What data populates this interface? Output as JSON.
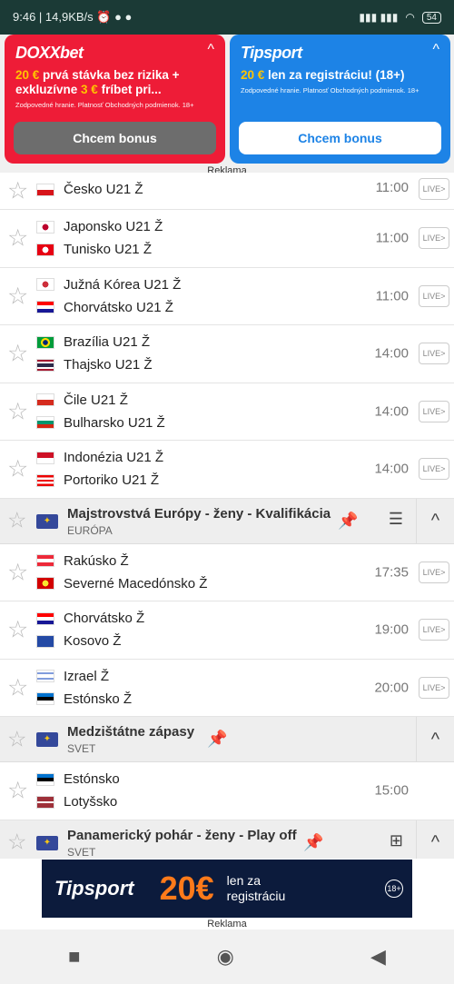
{
  "status": {
    "left": "9:46 | 14,9KB/s ⏰ ● ●",
    "right_signal": "▮▮▮ ▮▮▮",
    "wifi": "◠",
    "battery": "54"
  },
  "ads": {
    "doxx": {
      "logo": "DOXXbet",
      "chevron": "^",
      "text_a": "20 €",
      "text_b": " prvá stávka bez rizika + exkluzívne ",
      "text_c": "3 €",
      "text_d": " fríbet pri...",
      "small": "Zodpovedné hranie. Platnosť Obchodných podmienok. 18+",
      "button": "Chcem bonus"
    },
    "tip": {
      "logo": "Tipsport",
      "chevron": "^",
      "text_a": "20 €",
      "text_b": " len za registráciu! (18+)",
      "small": "Zodpovedné hranie. Platnosť Obchodných podmienok. 18+",
      "button": "Chcem bonus"
    },
    "label": "Reklama"
  },
  "rows": [
    {
      "team1": "Česko U21 Ž",
      "team2": "",
      "time": "11:00",
      "live": "LIVE>",
      "f1": "cz",
      "partial": true
    },
    {
      "team1": "Japonsko U21 Ž",
      "team2": "Tunisko U21 Ž",
      "time": "11:00",
      "live": "LIVE>",
      "f1": "jp",
      "f2": "tn"
    },
    {
      "team1": "Južná Kórea U21 Ž",
      "team2": "Chorvátsko U21 Ž",
      "time": "11:00",
      "live": "LIVE>",
      "f1": "kr",
      "f2": "hr"
    },
    {
      "team1": "Brazília U21 Ž",
      "team2": "Thajsko U21 Ž",
      "time": "14:00",
      "live": "LIVE>",
      "f1": "br",
      "f2": "th"
    },
    {
      "team1": "Čile U21 Ž",
      "team2": "Bulharsko U21 Ž",
      "time": "14:00",
      "live": "LIVE>",
      "f1": "cl",
      "f2": "bg"
    },
    {
      "team1": "Indonézia U21 Ž",
      "team2": "Portoriko U21 Ž",
      "time": "14:00",
      "live": "LIVE>",
      "f1": "id",
      "f2": "pr"
    }
  ],
  "league1": {
    "name": "Majstrovstvá Európy - ženy - Kvalifikácia",
    "region": "EURÓPA",
    "toggle": "^"
  },
  "rows2": [
    {
      "team1": "Rakúsko Ž",
      "team2": "Severné Macedónsko Ž",
      "time": "17:35",
      "live": "LIVE>"
    },
    {
      "team1": "Chorvátsko Ž",
      "team2": "Kosovo Ž",
      "time": "19:00",
      "live": "LIVE>"
    },
    {
      "team1": "Izrael Ž",
      "team2": "Estónsko Ž",
      "time": "20:00",
      "live": "LIVE>"
    }
  ],
  "league2": {
    "name": "Medzištátne zápasy",
    "region": "SVET",
    "toggle": "^"
  },
  "rows3": [
    {
      "team1": "Estónsko",
      "team2": "Lotyšsko",
      "time": "15:00"
    }
  ],
  "league3": {
    "name": "Panamerický pohár - ženy - Play off",
    "region": "SVET",
    "toggle": "^"
  },
  "banner": {
    "logo": "Tipsport",
    "amount": "20€",
    "text1": "len za",
    "text2": "registráciu",
    "age": "18+"
  },
  "bottom_label": "Reklama",
  "nav": {
    "back": "◀",
    "home": "◉",
    "recent": "■"
  },
  "colors": {
    "doxx": "#ee1c37",
    "tipsport": "#1d83e6",
    "accent": "#ffc400"
  }
}
